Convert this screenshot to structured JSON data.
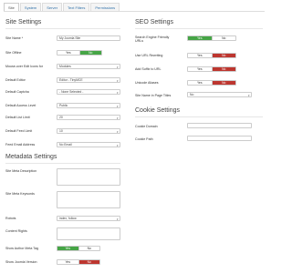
{
  "tabs": [
    "Site",
    "System",
    "Server",
    "Text Filters",
    "Permissions"
  ],
  "site_settings": {
    "title": "Site Settings",
    "fields": {
      "site_name": {
        "label": "Site Name *",
        "value": "My Joomla Site"
      },
      "site_offline": {
        "label": "Site Offline",
        "yes": "Yes",
        "no": "No",
        "selected": "No"
      },
      "mouse_over_edit_icons": {
        "label": "Mouse-over Edit Icons for",
        "value": "Modules"
      },
      "default_editor": {
        "label": "Default Editor",
        "value": "Editor - TinyMCE"
      },
      "default_captcha": {
        "label": "Default Captcha",
        "value": "- None Selected -"
      },
      "default_access_level": {
        "label": "Default Access Level",
        "value": "Public"
      },
      "default_list_limit": {
        "label": "Default List Limit",
        "value": "20"
      },
      "default_feed_limit": {
        "label": "Default Feed Limit",
        "value": "10"
      },
      "feed_email_address": {
        "label": "Feed Email Address",
        "value": "No Email"
      }
    }
  },
  "metadata_settings": {
    "title": "Metadata Settings",
    "fields": {
      "site_meta_description": {
        "label": "Site Meta Description"
      },
      "site_meta_keywords": {
        "label": "Site Meta Keywords"
      },
      "robots": {
        "label": "Robots",
        "value": "index, follow"
      },
      "content_rights": {
        "label": "Content Rights"
      },
      "show_author_meta_tag": {
        "label": "Show Author Meta Tag",
        "yes": "Yes",
        "no": "No",
        "selected": "Yes"
      },
      "show_joomla_version": {
        "label": "Show Joomla Version",
        "yes": "Yes",
        "no": "No",
        "selected": "No"
      }
    }
  },
  "seo_settings": {
    "title": "SEO Settings",
    "fields": {
      "search_engine_friendly_urls": {
        "label": "Search Engine Friendly URLs",
        "yes": "Yes",
        "no": "No",
        "selected": "Yes"
      },
      "use_url_rewriting": {
        "label": "Use URL Rewriting",
        "yes": "Yes",
        "no": "No",
        "selected": "No"
      },
      "add_suffix_to_url": {
        "label": "Add Suffix to URL",
        "yes": "Yes",
        "no": "No",
        "selected": "No"
      },
      "unicode_aliases": {
        "label": "Unicode Aliases",
        "yes": "Yes",
        "no": "No",
        "selected": "No"
      },
      "site_name_in_page_titles": {
        "label": "Site Name in Page Titles",
        "value": "No"
      }
    }
  },
  "cookie_settings": {
    "title": "Cookie Settings",
    "fields": {
      "cookie_domain": {
        "label": "Cookie Domain"
      },
      "cookie_path": {
        "label": "Cookie Path"
      }
    }
  },
  "icons": {
    "dropdown": "caret-down-icon"
  }
}
